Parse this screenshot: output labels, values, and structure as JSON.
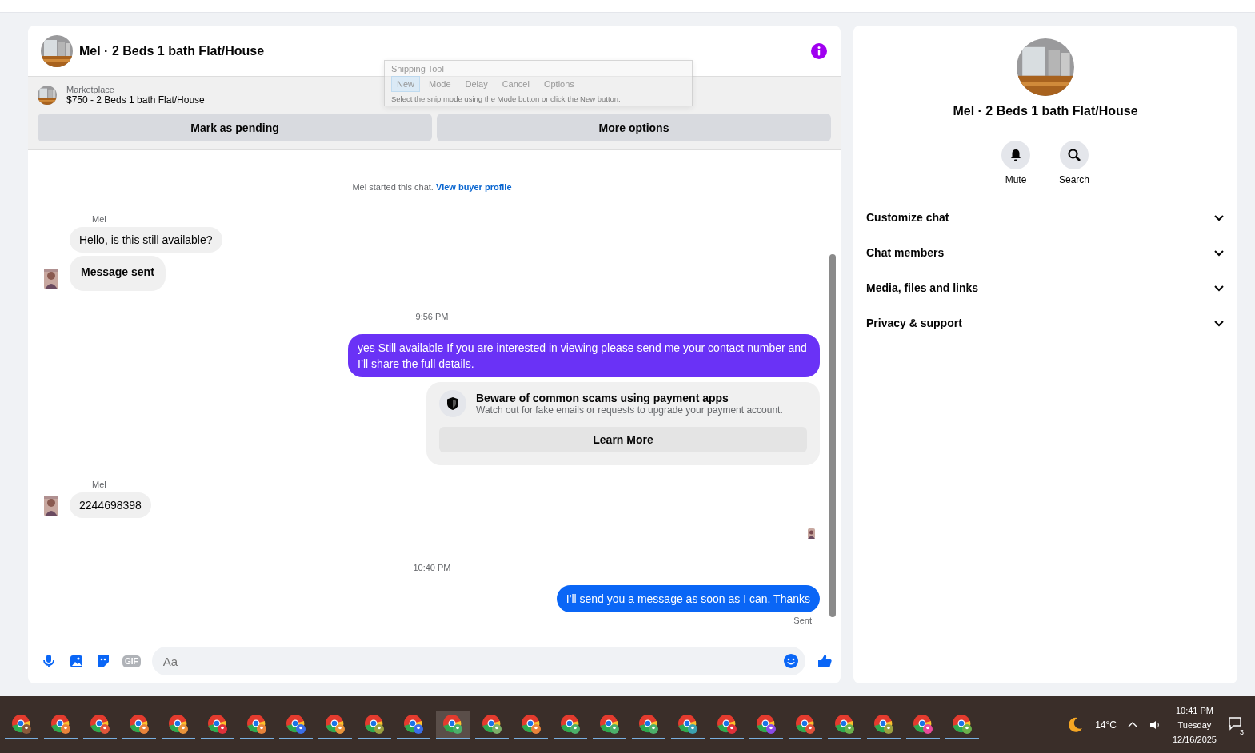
{
  "chat": {
    "title": "Mel · 2 Beds 1 bath Flat/House",
    "listing": {
      "source": "Marketplace",
      "summary": "$750 - 2 Beds 1 bath Flat/House",
      "actions": [
        "Mark as pending",
        "More options"
      ]
    },
    "messages": [
      {
        "kind": "notice",
        "text": "Mel started this chat.",
        "link": "View buyer profile"
      },
      {
        "kind": "sender",
        "text": "Mel"
      },
      {
        "kind": "incoming",
        "text": "Hello, is this still available?",
        "avatar": false,
        "bold": false
      },
      {
        "kind": "incoming",
        "text": "Message sent",
        "avatar": true,
        "bold": true
      },
      {
        "kind": "time",
        "text": "9:56 PM"
      },
      {
        "kind": "outgoing",
        "text": "yes Still available If you are interested in viewing please send me your contact number and I’ll share the full details.",
        "color": "#6a32f6"
      },
      {
        "kind": "warning",
        "title": "Beware of common scams using payment apps",
        "text": "Watch out for fake emails or requests to upgrade your payment account.",
        "button": "Learn More"
      },
      {
        "kind": "sender",
        "text": "Mel"
      },
      {
        "kind": "incoming",
        "text": "2244698398",
        "avatar": true,
        "bold": false
      },
      {
        "kind": "seen"
      },
      {
        "kind": "time",
        "text": "10:40 PM"
      },
      {
        "kind": "outgoing",
        "text": "I'll send you a message as soon as I can. Thanks",
        "color": "#0a66f6"
      },
      {
        "kind": "status",
        "text": "Sent"
      }
    ],
    "composer": {
      "gif_label": "GIF",
      "placeholder": "Aa"
    }
  },
  "snipping_tool": {
    "title": "Snipping Tool",
    "buttons": [
      {
        "label": "New",
        "selected": true
      },
      {
        "label": "Mode",
        "selected": false
      },
      {
        "label": "Delay",
        "selected": false
      },
      {
        "label": "Cancel",
        "selected": false
      },
      {
        "label": "Options",
        "selected": false
      }
    ],
    "hint": "Select the snip mode using the Mode button or click the New button."
  },
  "details": {
    "title": "Mel · 2 Beds 1 bath Flat/House",
    "actions": [
      {
        "kind": "mute",
        "label": "Mute"
      },
      {
        "kind": "search",
        "label": "Search"
      }
    ],
    "sections": [
      {
        "label": "Customize chat",
        "expanded": false
      },
      {
        "label": "Chat members",
        "expanded": false
      },
      {
        "label": "Media, files and links",
        "expanded": false
      },
      {
        "label": "Privacy & support",
        "expanded": false
      }
    ]
  },
  "taskbar": {
    "apps": [
      {
        "color": "#8a5a3a",
        "selected": false
      },
      {
        "color": "#e8833a",
        "selected": false
      },
      {
        "color": "#e2553a",
        "selected": false
      },
      {
        "color": "#e8833a",
        "selected": false
      },
      {
        "color": "#e8933a",
        "selected": false
      },
      {
        "color": "#e0303a",
        "selected": false
      },
      {
        "color": "#e8833a",
        "selected": false
      },
      {
        "color": "#3a6ee8",
        "selected": false
      },
      {
        "color": "#e8933a",
        "selected": false
      },
      {
        "color": "#9aa040",
        "selected": false
      },
      {
        "color": "#3a6ee8",
        "selected": false
      },
      {
        "color": "#4caf6a",
        "selected": true
      },
      {
        "color": "#7cb06a",
        "selected": false
      },
      {
        "color": "#e8833a",
        "selected": false
      },
      {
        "color": "#4caf6a",
        "selected": false
      },
      {
        "color": "#4caf6a",
        "selected": false
      },
      {
        "color": "#4caf6a",
        "selected": false
      },
      {
        "color": "#3aa0b0",
        "selected": false
      },
      {
        "color": "#e0303a",
        "selected": false
      },
      {
        "color": "#8a4ae8",
        "selected": false
      },
      {
        "color": "#e0503a",
        "selected": false
      },
      {
        "color": "#6ab04c",
        "selected": false
      },
      {
        "color": "#9aa040",
        "selected": false
      },
      {
        "color": "#e84a9a",
        "selected": false
      },
      {
        "color": "#6ab04c",
        "selected": false
      }
    ],
    "weather": "14°C",
    "time": "10:41 PM",
    "day": "Tuesday",
    "date": "12/16/2025",
    "notifications": "3"
  }
}
